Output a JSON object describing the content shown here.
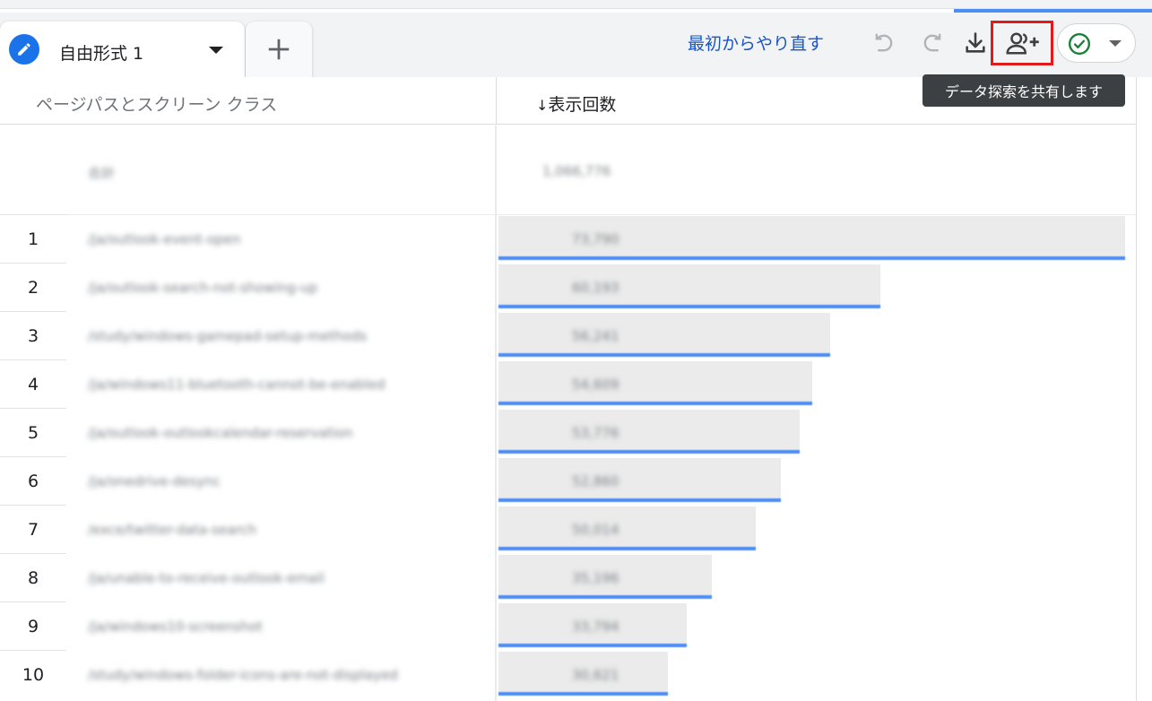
{
  "tab": {
    "label": "自由形式 1"
  },
  "toolbar": {
    "restart_label": "最初からやり直す",
    "share_tooltip": "データ探索を共有します"
  },
  "table": {
    "headers": {
      "dimension": "ページパスとスクリーン クラス",
      "metric_sort": "↓",
      "metric": "表示回数"
    },
    "total": {
      "dimension": "合計",
      "value": "1,066,776"
    },
    "rows": [
      {
        "num": "1",
        "dimension": "/ja/outlook-event-open",
        "value": "73,790",
        "fraction": 1.0
      },
      {
        "num": "2",
        "dimension": "/ja/outlook-search-not-showing-up",
        "value": "60,193",
        "fraction": 0.61
      },
      {
        "num": "3",
        "dimension": "/study/windows-gamepad-setup-methods",
        "value": "56,241",
        "fraction": 0.53
      },
      {
        "num": "4",
        "dimension": "/ja/windows11-bluetooth-cannot-be-enabled",
        "value": "54,609",
        "fraction": 0.5
      },
      {
        "num": "5",
        "dimension": "/ja/outlook-outlookcalendar-reservation",
        "value": "53,776",
        "fraction": 0.48
      },
      {
        "num": "6",
        "dimension": "/ja/onedrive-desync",
        "value": "52,860",
        "fraction": 0.45
      },
      {
        "num": "7",
        "dimension": "/exce/twitter-data-search",
        "value": "50,014",
        "fraction": 0.41
      },
      {
        "num": "8",
        "dimension": "/ja/unable-to-receive-outlook-email",
        "value": "35,196",
        "fraction": 0.34
      },
      {
        "num": "9",
        "dimension": "/ja/windows10-screenshot",
        "value": "33,794",
        "fraction": 0.3
      },
      {
        "num": "10",
        "dimension": "/study/windows-folder-icons-are-not-displayed",
        "value": "30,621",
        "fraction": 0.27
      }
    ]
  },
  "colors": {
    "accent": "#1a73e8",
    "bar": "#ebebeb",
    "bar_line": "#4c8df6",
    "highlight": "#e01b1b",
    "check": "#188038"
  },
  "icons": [
    "pencil-icon",
    "plus-icon",
    "undo-icon",
    "redo-icon",
    "download-icon",
    "share-people-icon",
    "check-circle-icon",
    "caret-down-icon"
  ]
}
